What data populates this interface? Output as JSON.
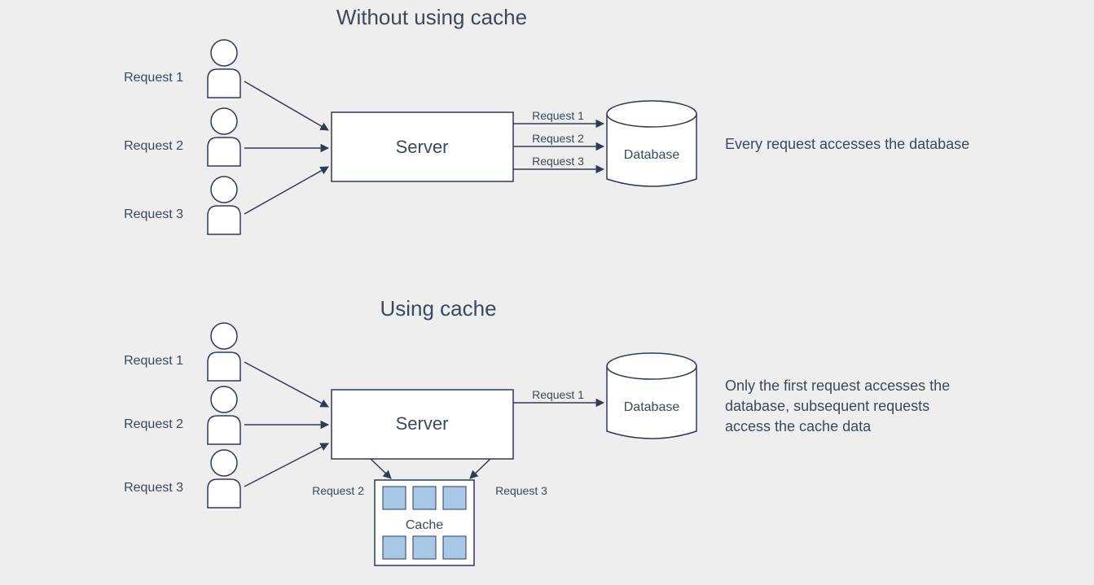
{
  "section1": {
    "title": "Without using cache",
    "user_labels": [
      "Request 1",
      "Request 2",
      "Request 3"
    ],
    "server_label": "Server",
    "arrow_labels": [
      "Request 1",
      "Request 2",
      "Request 3"
    ],
    "db_label": "Database",
    "description": "Every request accesses the database"
  },
  "section2": {
    "title": "Using cache",
    "user_labels": [
      "Request 1",
      "Request 2",
      "Request 3"
    ],
    "server_label": "Server",
    "arrow_label_db": "Request 1",
    "cache_arrow_labels": [
      "Request 2",
      "Request 3"
    ],
    "db_label": "Database",
    "cache_label": "Cache",
    "description_line1": "Only the first request accesses the",
    "description_line2": "database, subsequent requests",
    "description_line3": "access the cache data"
  }
}
